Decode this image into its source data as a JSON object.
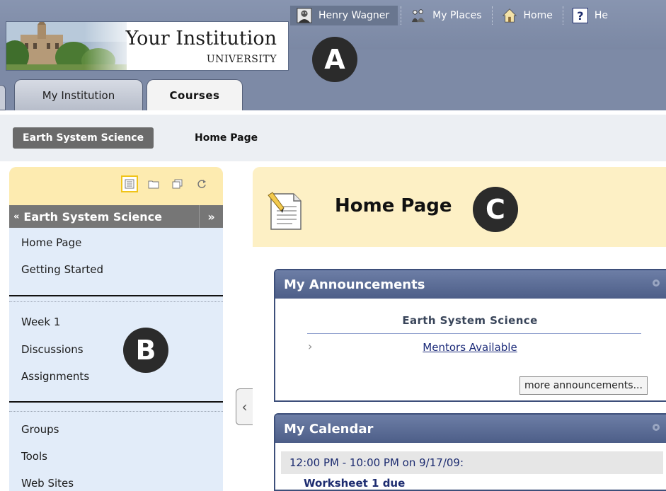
{
  "header": {
    "institution_name": "Your Institution",
    "institution_sub": "UNIVERSITY",
    "nav": {
      "user_name": "Henry Wagner",
      "my_places": "My Places",
      "home": "Home",
      "help": "He"
    },
    "tabs": [
      {
        "label": "My Institution",
        "active": false
      },
      {
        "label": "Courses",
        "active": true
      }
    ]
  },
  "callouts": {
    "a": "A",
    "b": "B",
    "c": "C"
  },
  "breadcrumb": {
    "course": "Earth System Science",
    "page": "Home Page"
  },
  "course_menu": {
    "icons": [
      "list-view-icon",
      "folder-view-icon",
      "window-icon",
      "refresh-icon"
    ],
    "title": "Earth System Science",
    "collapse_glyph": "«",
    "expand_glyph": "»",
    "groups": [
      [
        "Home Page",
        "Getting Started"
      ],
      [
        "Week 1",
        "Discussions",
        "Assignments"
      ],
      [
        "Groups",
        "Tools",
        "Web Sites"
      ]
    ]
  },
  "toggle_glyph": "‹",
  "page_header": {
    "title": "Home Page"
  },
  "announcements": {
    "title": "My Announcements",
    "course": "Earth System Science",
    "item": "Mentors Available",
    "more": "more announcements..."
  },
  "calendar": {
    "title": "My Calendar",
    "time": "12:00 PM - 10:00 PM on 9/17/09:",
    "item": "Worksheet 1 due"
  },
  "colors": {
    "header_bg": "#7d8aa6",
    "menu_bg": "#e2ecf9",
    "menu_top_bg": "#fdebb0",
    "page_header_bg": "#fdf0c5",
    "panel_header": "#4d5e88"
  }
}
